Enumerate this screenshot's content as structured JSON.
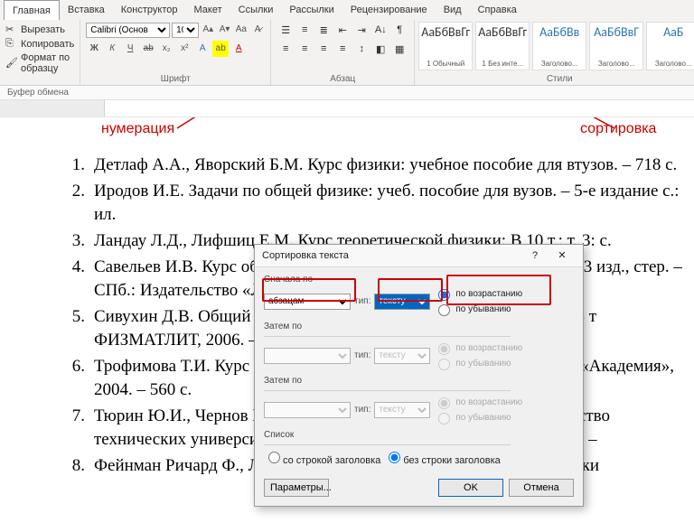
{
  "tabs": {
    "t0": "Главная",
    "t1": "Вставка",
    "t2": "Конструктор",
    "t3": "Макет",
    "t4": "Ссылки",
    "t5": "Рассылки",
    "t6": "Рецензирование",
    "t7": "Вид",
    "t8": "Справка"
  },
  "clip": {
    "cut": "Вырезать",
    "copy": "Копировать",
    "fmt": "Формат по образцу",
    "group": "Буфер обмена"
  },
  "font": {
    "name": "Calibri (Основ",
    "size": "10",
    "group": "Шрифт"
  },
  "para": {
    "group": "Абзац"
  },
  "styles": {
    "s0": "АаБбВвГг",
    "s1": "АаБбВвГг",
    "s2": "АаБбВв",
    "s3": "АаБбВвГ",
    "s4": "АаБ",
    "l0": "1 Обычный",
    "l1": "1 Без инте...",
    "l2": "Заголово...",
    "l3": "Заголово...",
    "l4": "Заголово...",
    "group": "Стили"
  },
  "anno": {
    "num": "нумерация",
    "sort": "сортировка"
  },
  "doc": {
    "i1": "Детлаф А.А., Яворский Б.М. Курс физики: учебное пособие для втузов. – 718 с.",
    "i2": "Иродов И.Е. Задачи по общей физике: учеб. пособие для вузов. – 5-е издание с.: ил.",
    "i3": "Ландау Л.Д., Лифшиц Е.М. Курс теоретической физики: В 10 т.: т. 3: с.",
    "i4": "Савельев И.В. Курс общей физики: учебное пособие. В 3-х тт. Т.2: 3 изд., стер. – СПб.: Издательство «Лань», 2007. – 496 с.: ил – (Учебни",
    "i5": "Сивухин Д.В. Общий курс физики: учебное пособие для вузов. В 5 т ФИЗМАТЛИТ, 2006. – 656 с.",
    "i6": "Трофимова Т.И. Курс физики: учеб. пособие для вузов. – Изд. 9-е, «Академия», 2004. – 560 с.",
    "i7": "Тюрин Ю.И., Чернов И.П., Крючков Ю.Ю. Физика ч.2. Электричество технических университетов. – Томск: Изд-во Томского ун-та, 2003. –",
    "i8": "Фейнман Ричард Ф., Лейтон Роберт Б., Сэндс Метью. Фейхмановски"
  },
  "dialog": {
    "title": "Сортировка текста",
    "first": "Сначала по",
    "then": "Затем по",
    "type": "тип:",
    "field_para": "абзацам",
    "field_text": "тексту",
    "asc": "по возрастанию",
    "desc": "по убыванию",
    "list": "Список",
    "withhdr": "со строкой заголовка",
    "nohdr": "без строки заголовка",
    "params": "Параметры...",
    "ok": "OK",
    "cancel": "Отмена"
  }
}
